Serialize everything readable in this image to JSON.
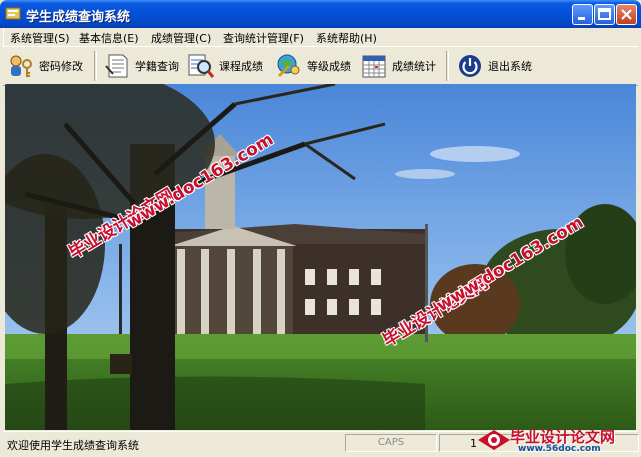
{
  "window": {
    "title": "学生成绩查询系统",
    "icon": "app-icon"
  },
  "menu": [
    {
      "label": "系统管理(S)"
    },
    {
      "label": "基本信息(E)"
    },
    {
      "label": "成绩管理(C)"
    },
    {
      "label": "查询统计管理(F)"
    },
    {
      "label": "系统帮助(H)"
    }
  ],
  "toolbar": [
    {
      "label": "密码修改",
      "icon": "keys-user-icon"
    },
    {
      "label": "学籍查询",
      "icon": "document-icon"
    },
    {
      "label": "课程成绩",
      "icon": "magnifier-report-icon"
    },
    {
      "label": "等级成绩",
      "icon": "globe-magnifier-icon"
    },
    {
      "label": "成绩统计",
      "icon": "calendar-grid-icon"
    },
    {
      "label": "退出系统",
      "icon": "power-icon"
    }
  ],
  "watermarks": {
    "text1": "毕业设计论文网",
    "text2": "www.doc163.com"
  },
  "status": {
    "welcome": "欢迎使用学生成绩查询系统",
    "caps": "CAPS",
    "num": "1"
  },
  "logo_watermark": {
    "line1": "毕业设计论文网",
    "line2": "www.56doc.com"
  },
  "colors": {
    "titlebar": "#0550d8",
    "chrome": "#ece9d8",
    "watermark": "#c8102e"
  }
}
